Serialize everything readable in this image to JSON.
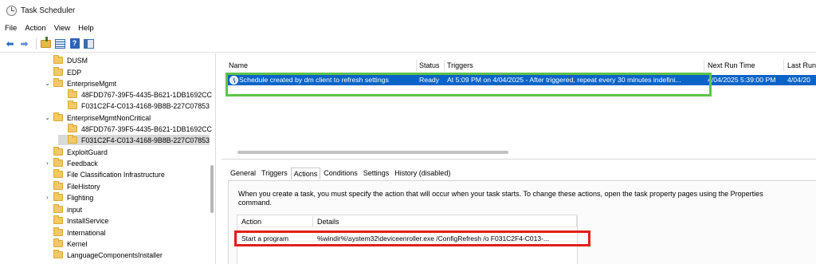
{
  "window": {
    "title": "Task Scheduler",
    "icon": "clock-icon"
  },
  "menu": [
    "File",
    "Action",
    "View",
    "Help"
  ],
  "toolbar": {
    "icons": [
      "back-arrow-icon",
      "forward-arrow-icon",
      "up-folder-icon",
      "show-hide-console-tree-icon",
      "help-icon",
      "show-hide-action-pane-icon"
    ],
    "back_glyph": "⬅",
    "forward_glyph": "➡",
    "help_glyph": "?"
  },
  "tree": {
    "items": [
      {
        "label": "DUSM",
        "expander": ""
      },
      {
        "label": "EDP",
        "expander": ""
      },
      {
        "label": "EnterpriseMgmt",
        "expander": "⌄"
      },
      {
        "label": "48FDD767-39F5-4435-B621-1DB1692CC",
        "expander": ""
      },
      {
        "label": "F031C2F4-C013-4168-9B8B-227C07853",
        "expander": ""
      },
      {
        "label": "EnterpriseMgmtNonCritical",
        "expander": "⌄"
      },
      {
        "label": "48FDD767-39F5-4435-B621-1DB1692CC",
        "expander": ""
      },
      {
        "label": "F031C2F4-C013-4168-9B8B-227C07853",
        "expander": "",
        "selected": true
      },
      {
        "label": "ExploitGuard",
        "expander": ""
      },
      {
        "label": "Feedback",
        "expander": "›"
      },
      {
        "label": "File Classification Infrastructure",
        "expander": ""
      },
      {
        "label": "FileHistory",
        "expander": ""
      },
      {
        "label": "Flighting",
        "expander": "›"
      },
      {
        "label": "input",
        "expander": ""
      },
      {
        "label": "InstallService",
        "expander": ""
      },
      {
        "label": "International",
        "expander": ""
      },
      {
        "label": "Kernel",
        "expander": ""
      },
      {
        "label": "LanguageComponentsInstaller",
        "expander": ""
      }
    ]
  },
  "task_list": {
    "columns": [
      "Name",
      "Status",
      "Triggers",
      "Next Run Time",
      "Last Run"
    ],
    "rows": [
      {
        "name": "Schedule created by dm client to refresh settings",
        "status": "Ready",
        "triggers": "At 5:09 PM on 4/04/2025 - After triggered, repeat every 30 minutes indefini...",
        "next_run": "4/04/2025 5:39:00 PM",
        "last_run": "4/04/20",
        "selected": true
      }
    ],
    "highlight_color": "#5fc24a"
  },
  "details": {
    "tabs": [
      "General",
      "Triggers",
      "Actions",
      "Conditions",
      "Settings",
      "History (disabled)"
    ],
    "active_tab": "Actions",
    "description": "When you create a task, you must specify the action that will occur when your task starts.  To change these actions, open the task property pages using the Properties command.",
    "actions_table": {
      "columns": [
        "Action",
        "Details"
      ],
      "rows": [
        {
          "action": "Start a program",
          "details": "%windir%\\system32\\deviceenroller.exe /ConfigRefresh /o F031C2F4-C013-..."
        }
      ]
    },
    "highlight_color": "#e0201b"
  }
}
